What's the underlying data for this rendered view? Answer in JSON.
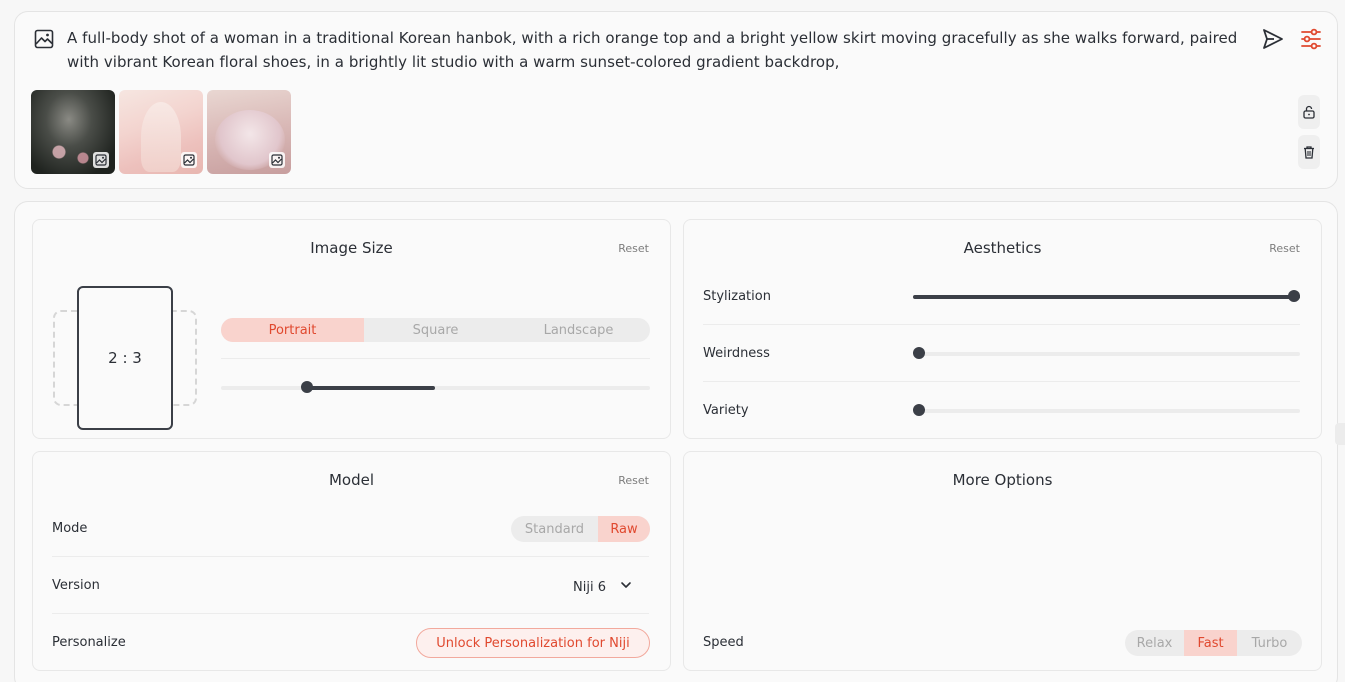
{
  "prompt": {
    "text": "A full-body shot of a woman in a traditional Korean hanbok, with a rich orange top and a bright yellow skirt moving gracefully as she walks forward, paired with vibrant Korean floral shoes, in a brightly lit studio with a warm sunset-colored gradient backdrop,",
    "icon": "image-icon",
    "send_icon": "send-icon",
    "settings_icon": "sliders-icon",
    "lock_icon": "unlock-icon",
    "trash_icon": "trash-icon",
    "thumbnails": [
      {
        "badge_icon": "image-reference-icon"
      },
      {
        "badge_icon": "image-reference-icon"
      },
      {
        "badge_icon": "image-reference-icon"
      }
    ]
  },
  "image_size": {
    "title": "Image Size",
    "reset": "Reset",
    "aspect_ratio": "2 : 3",
    "orientations": [
      "Portrait",
      "Square",
      "Landscape"
    ],
    "selected_orientation": "Portrait",
    "ratio_slider": {
      "from": 0.2,
      "to": 0.5
    }
  },
  "aesthetics": {
    "title": "Aesthetics",
    "reset": "Reset",
    "rows": [
      {
        "label": "Stylization",
        "value": 1.0
      },
      {
        "label": "Weirdness",
        "value": 0.0
      },
      {
        "label": "Variety",
        "value": 0.0
      }
    ]
  },
  "model": {
    "title": "Model",
    "reset": "Reset",
    "mode_label": "Mode",
    "modes": [
      "Standard",
      "Raw"
    ],
    "selected_mode": "Raw",
    "version_label": "Version",
    "version_value": "Niji 6",
    "personalize_label": "Personalize",
    "personalize_button": "Unlock Personalization for Niji"
  },
  "more_options": {
    "title": "More Options",
    "speed_label": "Speed",
    "speeds": [
      "Relax",
      "Fast",
      "Turbo"
    ],
    "selected_speed": "Fast"
  },
  "colors": {
    "accent": "#e0492f",
    "accent_bg": "#f9d3cd",
    "slider": "#3b3f47"
  }
}
